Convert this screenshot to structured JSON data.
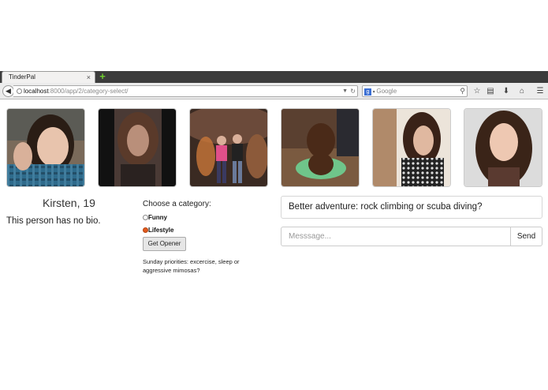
{
  "browser": {
    "tab_title": "TinderPal",
    "tab_close": "×",
    "new_tab": "+",
    "url_host": "localhost",
    "url_path": ":8000/app/2/category-select/",
    "search_placeholder": "Google",
    "search_engine_letter": "g"
  },
  "profile": {
    "name_age": "Kirsten, 19",
    "bio": "This person has no bio.",
    "photo_count": 6
  },
  "category": {
    "title": "Choose a category:",
    "options": [
      {
        "label": "Funny",
        "selected": false
      },
      {
        "label": "Lifestyle",
        "selected": true
      }
    ],
    "button_label": "Get Opener",
    "opener_text": "Sunday priorities: excercise, sleep or aggressive mimosas?"
  },
  "chat": {
    "answer": "Better adventure: rock climbing or scuba diving?",
    "message_placeholder": "Messsage...",
    "send_label": "Send"
  },
  "colors": {
    "tabstrip": "#3c3c3c",
    "radio_selected": "#e35a1e",
    "new_tab_green": "#6fcf2f"
  }
}
